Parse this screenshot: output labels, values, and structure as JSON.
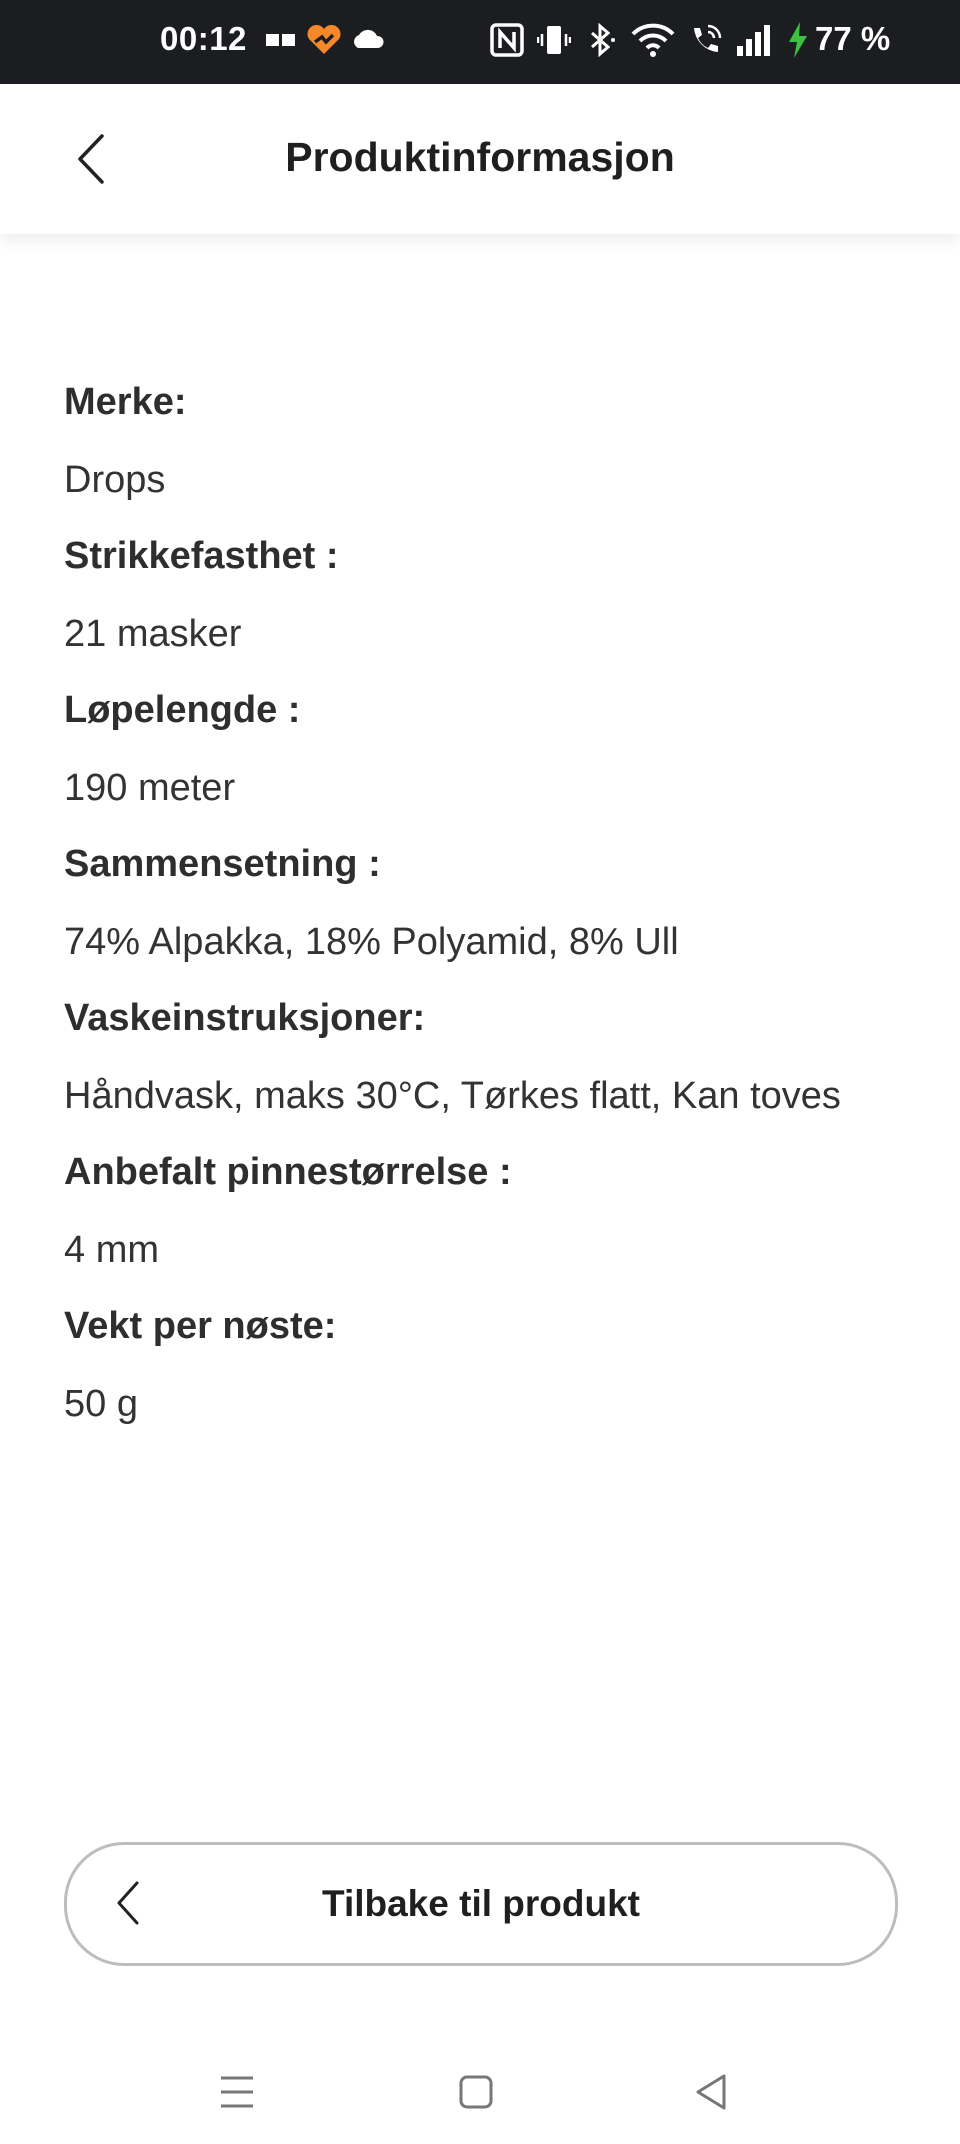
{
  "status_bar": {
    "time": "00:12",
    "battery": "77 %",
    "icons": [
      "message-icon",
      "heart-app-icon",
      "cloud-icon",
      "nfc-icon",
      "vibrate-icon",
      "bluetooth-icon",
      "wifi-icon",
      "wifi-call-icon",
      "signal-icon",
      "charging-icon"
    ],
    "accent_orange": "#f5892a",
    "charging_green": "#3ec143"
  },
  "header": {
    "title": "Produktinformasjon",
    "back_icon": "chevron-left-icon"
  },
  "product_info": [
    {
      "label": "Merke:",
      "value": "Drops"
    },
    {
      "label": "Strikkefasthet :",
      "value": "21 masker"
    },
    {
      "label": "Løpelengde :",
      "value": "190 meter"
    },
    {
      "label": "Sammensetning :",
      "value": "74% Alpakka, 18% Polyamid, 8% Ull"
    },
    {
      "label": "Vaskeinstruksjoner:",
      "value": "Håndvask, maks 30°C, Tørkes flatt, Kan toves"
    },
    {
      "label": "Anbefalt pinnestørrelse :",
      "value": "4 mm"
    },
    {
      "label": "Vekt per nøste:",
      "value": "50 g"
    }
  ],
  "footer_button": {
    "label": "Tilbake til produkt",
    "icon": "chevron-left-icon"
  },
  "nav_bar": {
    "buttons": [
      "menu-icon",
      "home-icon",
      "back-triangle-icon"
    ]
  }
}
